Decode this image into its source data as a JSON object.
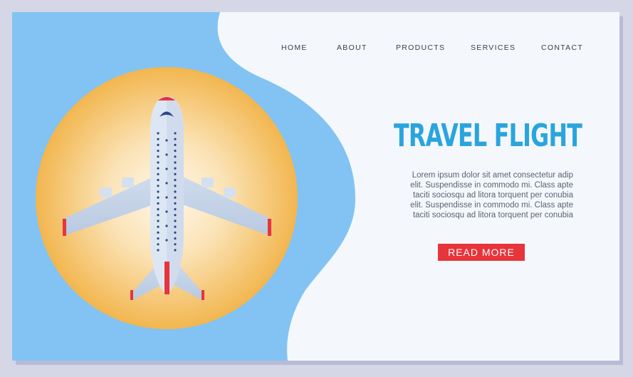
{
  "nav": {
    "items": [
      {
        "label": "HOME"
      },
      {
        "label": "ABOUT"
      },
      {
        "label": "PRODUCTS"
      },
      {
        "label": "SERVICES"
      },
      {
        "label": "CONTACT"
      }
    ]
  },
  "hero": {
    "title": "TRAVEL FLIGHT",
    "body_lines": [
      "Lorem ipsum dolor sit amet  consectetur adip",
      "elit. Suspendisse in commodo mi. Class apte",
      "taciti sociosqu ad litora torquent per conubia",
      "elit. Suspendisse in commodo mi. Class apte",
      "taciti sociosqu ad litora torquent per conubia"
    ],
    "cta_label": "READ MORE"
  },
  "colors": {
    "panel_blue": "#82c3f3",
    "accent_blue": "#2aa4de",
    "sun_orange": "#f2b64f",
    "button_red": "#e8343b",
    "page_bg": "#f4f8fc"
  },
  "icons": {
    "illustration": "airplane-top-view",
    "backdrop": "sun-circle"
  }
}
